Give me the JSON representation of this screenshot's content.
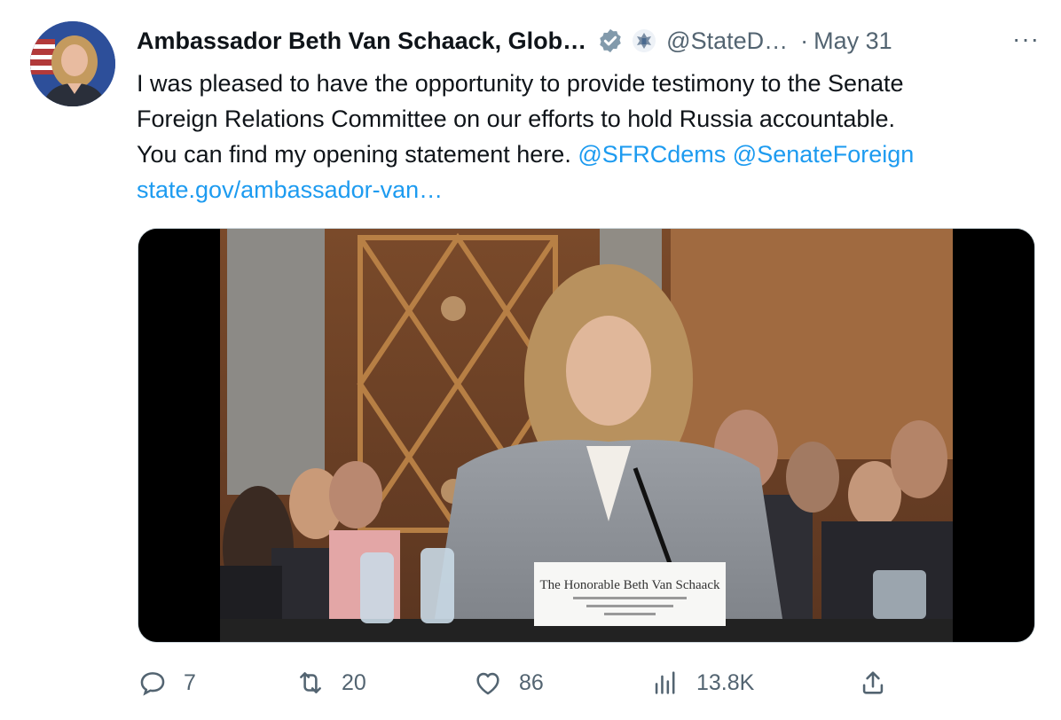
{
  "tweet": {
    "author_name": "Ambassador Beth Van Schaack, Glob…",
    "handle": "@StateD…",
    "separator": "·",
    "date": "May 31",
    "more_label": "···",
    "text_line1": "I was pleased to have the opportunity to provide testimony to the Senate",
    "text_line2": "Foreign Relations Committee on our efforts to hold Russia accountable.",
    "text_line3": "You can find my opening statement here.",
    "mention1": "@SFRCdems",
    "mention2": "@SenateForeign",
    "url": "state.gov/ambassador-van…"
  },
  "media": {
    "nameplate_title": "The Honorable Beth Van Schaack"
  },
  "actions": {
    "replies": "7",
    "retweets": "20",
    "likes": "86",
    "views": "13.8K"
  },
  "colors": {
    "link": "#1d9bf0",
    "secondary_text": "#536471",
    "verified": "#829aab"
  },
  "icons": [
    "reply-icon",
    "retweet-icon",
    "like-icon",
    "views-icon",
    "share-icon",
    "verified-badge-icon",
    "government-seal-icon"
  ]
}
